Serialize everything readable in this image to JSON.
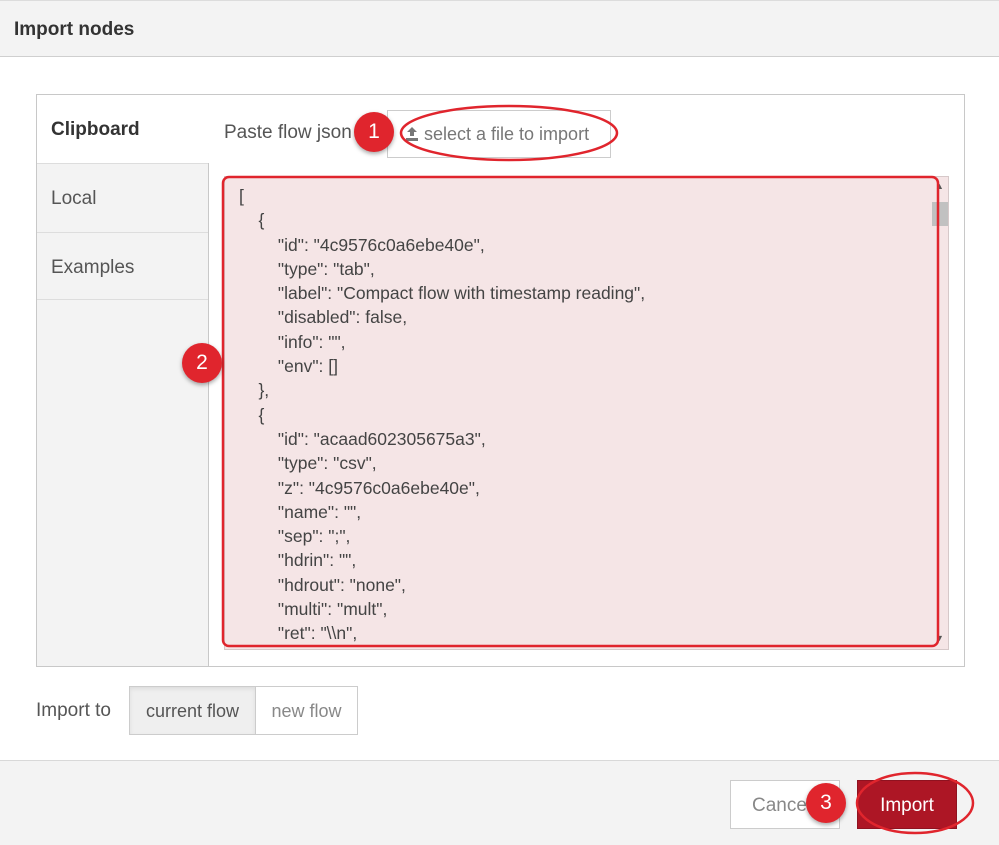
{
  "dialog": {
    "title": "Import nodes"
  },
  "tabs": [
    {
      "label": "Clipboard",
      "active": true
    },
    {
      "label": "Local",
      "active": false
    },
    {
      "label": "Examples",
      "active": false
    }
  ],
  "clipboard": {
    "paste_label": "Paste flow json or",
    "select_file_label": "select a file to import",
    "select_file_icon": "upload-icon",
    "editor_text": "[\n    {\n        \"id\": \"4c9576c0a6ebe40e\",\n        \"type\": \"tab\",\n        \"label\": \"Compact flow with timestamp reading\",\n        \"disabled\": false,\n        \"info\": \"\",\n        \"env\": []\n    },\n    {\n        \"id\": \"acaad602305675a3\",\n        \"type\": \"csv\",\n        \"z\": \"4c9576c0a6ebe40e\",\n        \"name\": \"\",\n        \"sep\": \";\",\n        \"hdrin\": \"\",\n        \"hdrout\": \"none\",\n        \"multi\": \"mult\",\n        \"ret\": \"\\\\n\",\n        \"temp\": \"\","
  },
  "import_to": {
    "label": "Import to",
    "options": [
      "current flow",
      "new flow"
    ],
    "selected": "current flow"
  },
  "footer": {
    "cancel_label": "Cancel",
    "import_label": "Import"
  },
  "annotations": [
    "1",
    "2",
    "3"
  ],
  "colors": {
    "annotation_red": "#e0252d",
    "import_button": "#ad1625",
    "editor_background": "#f5e5e6"
  }
}
